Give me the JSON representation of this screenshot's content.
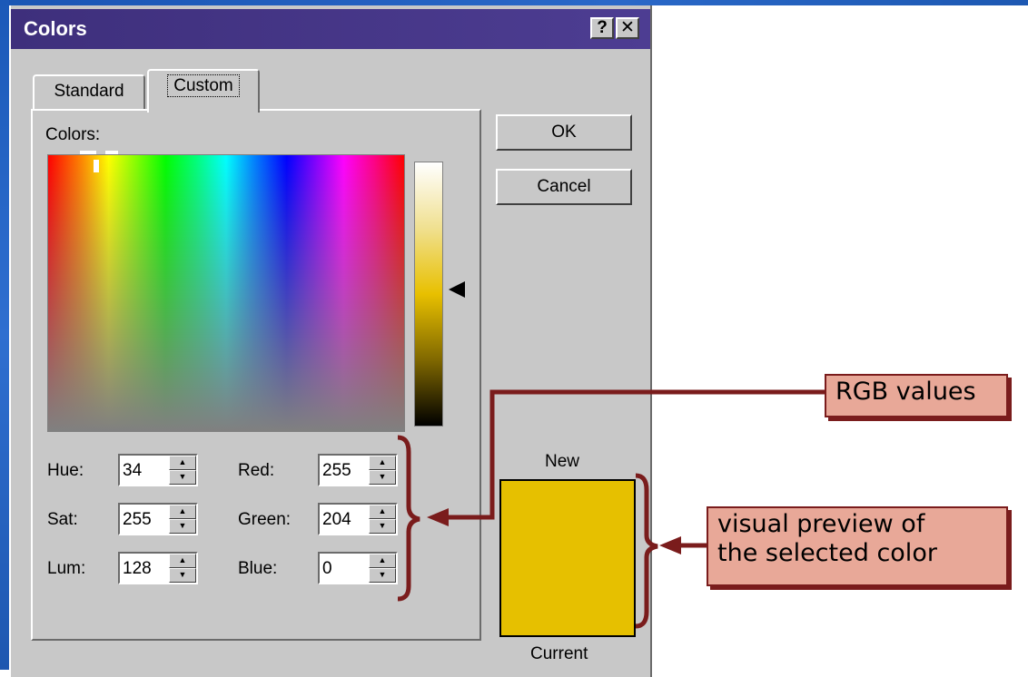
{
  "window": {
    "title": "Colors",
    "help_button": "?",
    "close_button": "✕"
  },
  "tabs": [
    {
      "label": "Standard",
      "active": false
    },
    {
      "label": "Custom",
      "active": true
    }
  ],
  "colors_label": "Colors:",
  "fields": {
    "hue": {
      "label": "Hue:",
      "value": "34"
    },
    "sat": {
      "label": "Sat:",
      "value": "255"
    },
    "lum": {
      "label": "Lum:",
      "value": "128"
    },
    "red": {
      "label": "Red:",
      "value": "255"
    },
    "green": {
      "label": "Green:",
      "value": "204"
    },
    "blue": {
      "label": "Blue:",
      "value": "0"
    }
  },
  "buttons": {
    "ok": "OK",
    "cancel": "Cancel"
  },
  "preview": {
    "new_label": "New",
    "current_label": "Current",
    "color": "#e6c000"
  },
  "annotations": {
    "rgb": "RGB values",
    "preview_line1": "visual preview of",
    "preview_line2": "the selected color"
  },
  "colors": {
    "titlebar": "#4a3a8a",
    "dialog": "#c8c8c8",
    "callout_fill": "#e8a898",
    "callout_line": "#7a1c1c"
  }
}
